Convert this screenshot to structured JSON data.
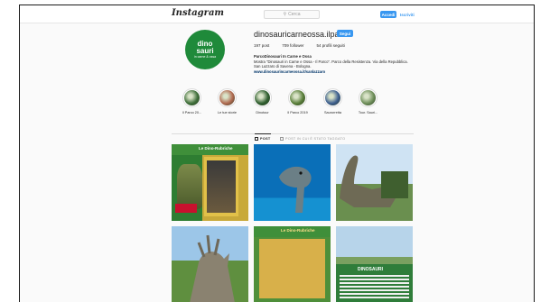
{
  "topbar": {
    "logo": "Instagram",
    "search_placeholder": "Cerca",
    "login_label": "Accedi",
    "signup_label": "Iscriviti"
  },
  "profile": {
    "avatar_text_main": "dino",
    "avatar_text_sub": "sauri",
    "avatar_text_caption": "in carne & ossa",
    "username": "dinosauricarneossa.ilparco",
    "follow_label": "Segui",
    "stats": {
      "posts": "197 post",
      "followers": "709 follower",
      "following": "54 profili seguiti"
    },
    "bio": {
      "name": "ParcoDinosauri In Carne e Ossa",
      "line1": "Mostra \"Dinosauri in Carne e Ossa - Il Parco\". Parco della Resistenza. Via della Repubblica.",
      "line2": "San Lazzaro di Savena - Bologna.",
      "link": "www.dinosaurincarneossa.it/sanlazzaro"
    }
  },
  "highlights": [
    {
      "label": "Il Parco 20...",
      "color": "#3f6f3a"
    },
    {
      "label": "Le tue storie",
      "color": "#b06a50"
    },
    {
      "label": "Dinotour",
      "color": "#2f5f2f"
    },
    {
      "label": "Il Parco 2019",
      "color": "#5a7f3a"
    },
    {
      "label": "Saurorretta",
      "color": "#3d5f8f"
    },
    {
      "label": "Tour. Sauri...",
      "color": "#6f8f5a"
    }
  ],
  "tabs": {
    "posts_label": "POST",
    "tagged_label": "POST IN CUI È STATO TAGGATO"
  },
  "grid": {
    "tile1_band": "Le Dino-Rubriche",
    "tile5_band": "Le Dino-Rubriche",
    "tile6_title": "DINOSAURI"
  }
}
